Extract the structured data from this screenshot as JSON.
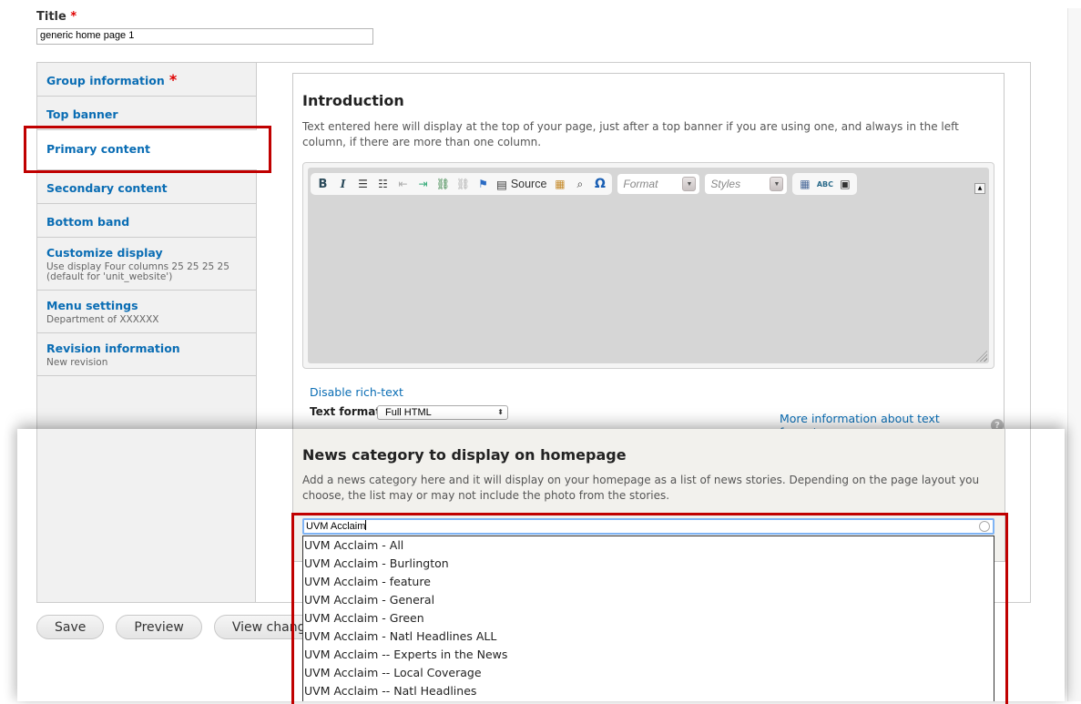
{
  "title_field": {
    "label": "Title",
    "required_mark": "*",
    "value": "generic home page 1"
  },
  "vertical_tabs": [
    {
      "title": "Group information",
      "required_mark": "*",
      "summary": ""
    },
    {
      "title": "Top banner",
      "summary": ""
    },
    {
      "title": "Primary content",
      "summary": "",
      "active": true
    },
    {
      "title": "Secondary content",
      "summary": ""
    },
    {
      "title": "Bottom band",
      "summary": ""
    },
    {
      "title": "Customize display",
      "summary_line1": "Use display Four columns 25 25 25 25",
      "summary_line2": "(default for 'unit_website')"
    },
    {
      "title": "Menu settings",
      "summary": "Department of XXXXXX"
    },
    {
      "title": "Revision information",
      "summary": "New revision"
    }
  ],
  "introduction": {
    "title": "Introduction",
    "description": "Text entered here will display at the top of your page, just after a top banner if you are using one, and always in the left column, if there are more than one column."
  },
  "editor": {
    "toolbar": {
      "bold": "B",
      "italic": "I",
      "bulleted_list": "☰",
      "numbered_list": "☷",
      "outdent": "⇤",
      "indent": "⇥",
      "link": "⛓",
      "unlink": "⛓",
      "anchor": "⚑",
      "source_icon": "▤",
      "source_label": "Source",
      "paste_word": "▦",
      "find": "⌕",
      "special_char": "Ω",
      "format_placeholder": "Format",
      "styles_placeholder": "Styles",
      "table": "▦",
      "spellcheck": "ABC",
      "image": "▣",
      "combo_arrow": "▼",
      "collapse": "▲"
    }
  },
  "text_format": {
    "disable_rich_text": "Disable rich-text",
    "label": "Text format",
    "selected": "Full HTML",
    "select_arrows": "⬍",
    "more_info": "More information about text formats",
    "help_icon": "?"
  },
  "news_category": {
    "title": "News category to display on homepage",
    "description": "Add a news category here and it will display on your homepage as a list of news stories. Depending on the page layout you choose, the list may or may not include the photo from the stories.",
    "input_value": "UVM Acclaim",
    "suggestions": [
      "UVM Acclaim - All",
      "UVM Acclaim - Burlington",
      "UVM Acclaim - feature",
      "UVM Acclaim - General",
      "UVM Acclaim - Green",
      "UVM Acclaim - Natl Headlines ALL",
      "UVM Acclaim -- Experts in the News",
      "UVM Acclaim -- Local Coverage",
      "UVM Acclaim -- Natl Headlines"
    ]
  },
  "actions": {
    "save": "Save",
    "preview": "Preview",
    "view_changes": "View changes"
  },
  "colors": {
    "link_blue": "#0a6db4",
    "highlight_red": "#c00000",
    "required_red": "#e00000",
    "tab_bg": "#f1f1f1",
    "news_bg": "#f2f1ed"
  }
}
